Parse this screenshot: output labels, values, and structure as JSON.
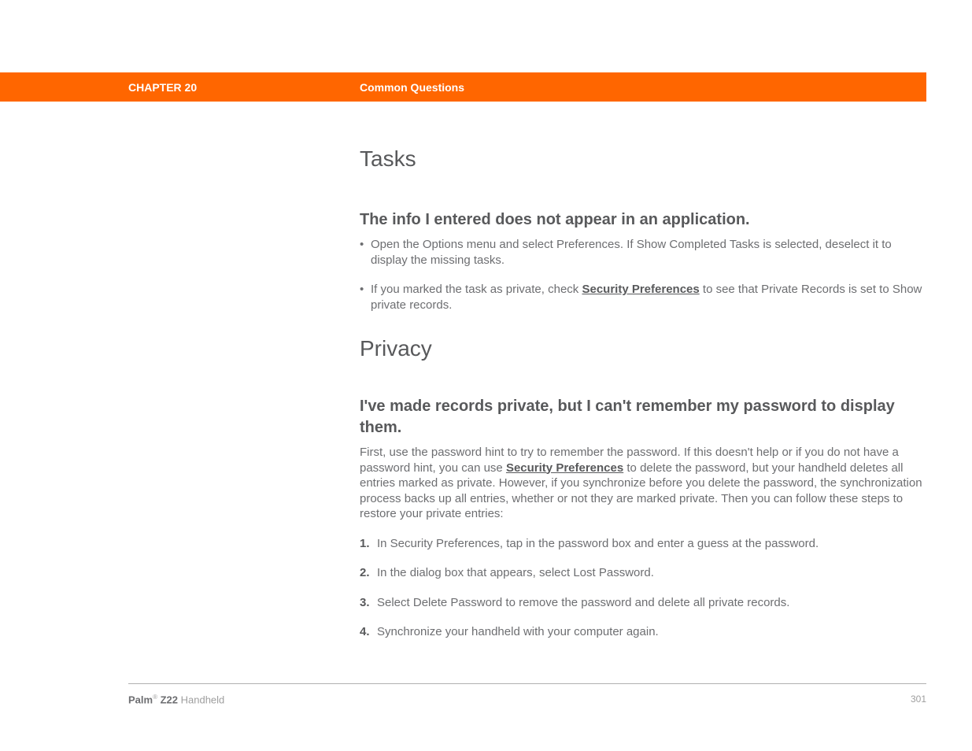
{
  "header": {
    "chapter": "CHAPTER 20",
    "title": "Common Questions"
  },
  "sections": {
    "tasks": {
      "heading": "Tasks",
      "q1": {
        "heading": "The info I entered does not appear in an application.",
        "bullet1": "Open the Options menu and select Preferences. If Show Completed Tasks is selected, deselect it to display the missing tasks.",
        "bullet2_pre": "If you marked the task as private, check ",
        "bullet2_link": "Security Preferences",
        "bullet2_post": " to see that Private Records is set to Show private records."
      }
    },
    "privacy": {
      "heading": "Privacy",
      "q1": {
        "heading": "I've made records private, but I can't remember my password to display them.",
        "para_pre": "First, use the password hint to try to remember the password. If this doesn't help or if you do not have a password hint, you can use ",
        "para_link": "Security Preferences",
        "para_post": " to delete the password, but your handheld deletes all entries marked as private. However, if you synchronize before you delete the password, the synchronization process backs up all entries, whether or not they are marked private. Then you can follow these steps to restore your private entries:",
        "steps": {
          "n1": "1.",
          "s1": "In Security Preferences, tap in the password box and enter a guess at the password.",
          "n2": "2.",
          "s2": "In the dialog box that appears, select Lost Password.",
          "n3": "3.",
          "s3": "Select Delete Password to remove the password and delete all private records.",
          "n4": "4.",
          "s4": "Synchronize your handheld with your computer again."
        }
      }
    }
  },
  "footer": {
    "brand_strong": "Palm",
    "brand_sup": "®",
    "brand_mid": " Z22",
    "brand_light": " Handheld",
    "page": "301"
  }
}
